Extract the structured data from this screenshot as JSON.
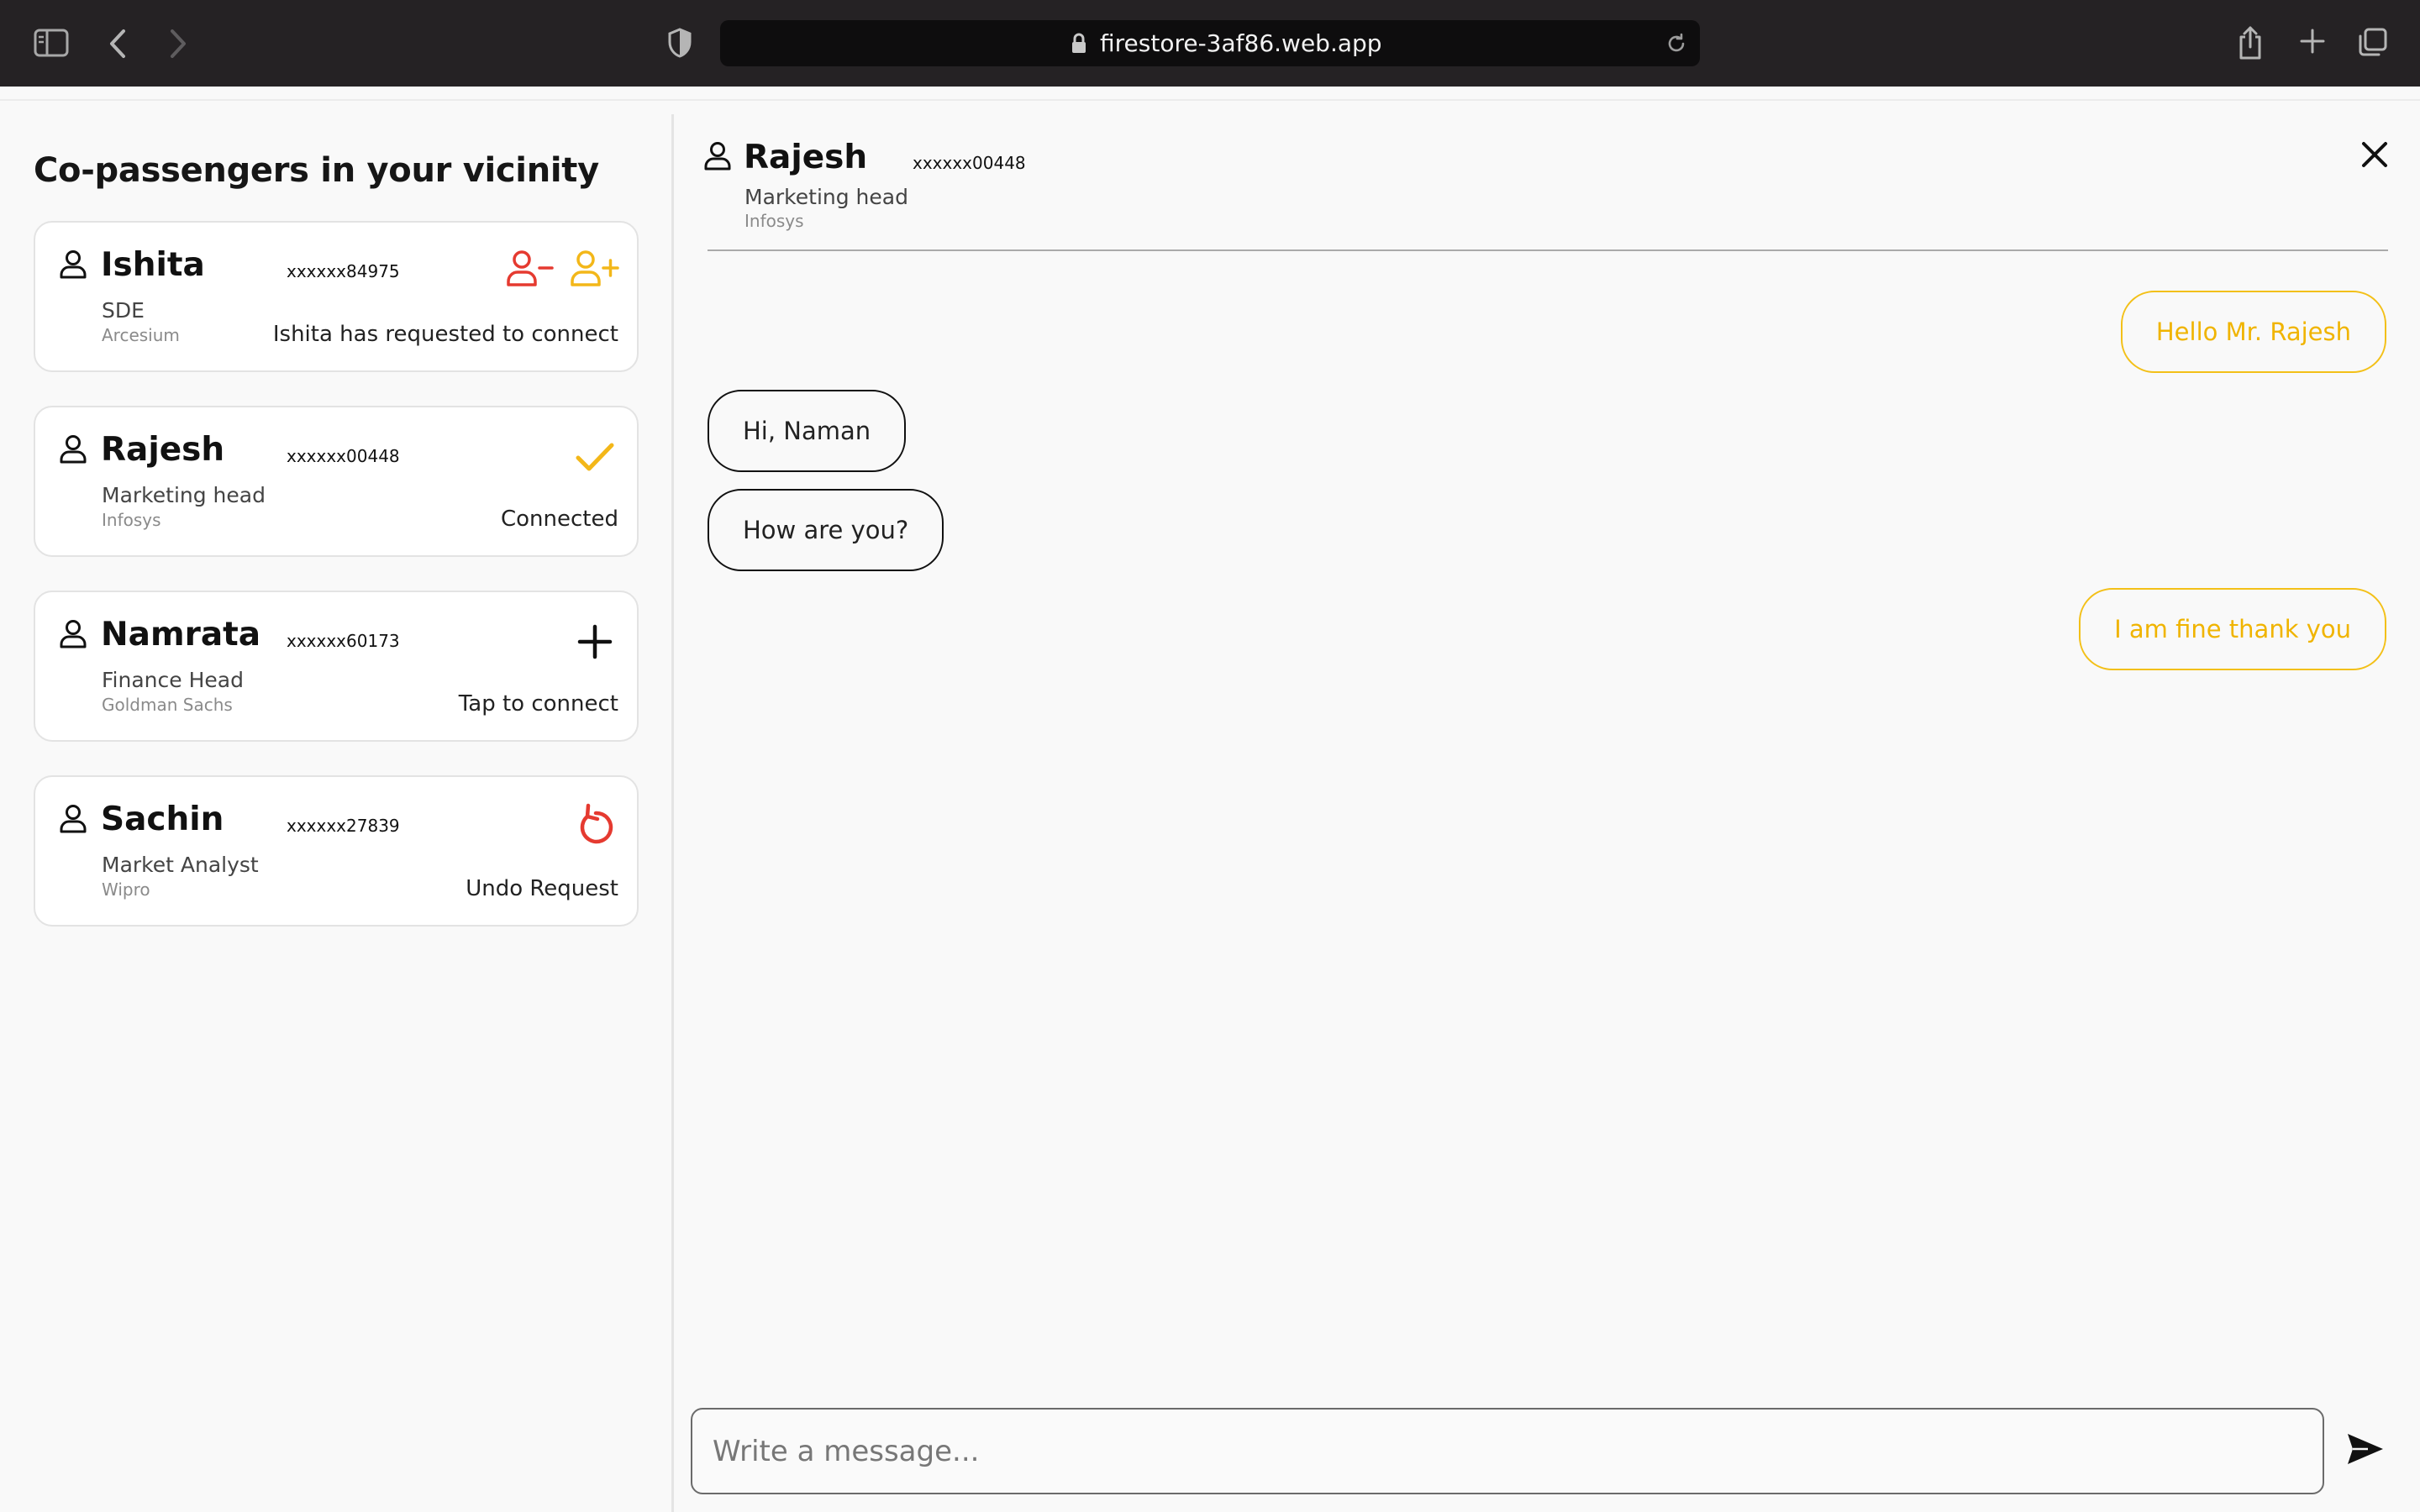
{
  "browser": {
    "url": "firestore-3af86.web.app"
  },
  "left": {
    "title": "Co-passengers in your vicinity",
    "cards": [
      {
        "name": "Ishita",
        "phone": "xxxxxx84975",
        "role": "SDE",
        "org": "Arcesium",
        "status": "Ishita has requested to connect"
      },
      {
        "name": "Rajesh",
        "phone": "xxxxxx00448",
        "role": "Marketing head",
        "org": "Infosys",
        "status": "Connected"
      },
      {
        "name": "Namrata",
        "phone": "xxxxxx60173",
        "role": "Finance Head",
        "org": "Goldman Sachs",
        "status": "Tap to connect"
      },
      {
        "name": "Sachin",
        "phone": "xxxxxx27839",
        "role": "Market Analyst",
        "org": "Wipro",
        "status": "Undo Request"
      }
    ]
  },
  "chat": {
    "name": "Rajesh",
    "phone": "xxxxxx00448",
    "role": "Marketing head",
    "org": "Infosys",
    "messages": [
      {
        "from": "me",
        "text": "Hello Mr. Rajesh"
      },
      {
        "from": "them",
        "text": "Hi, Naman"
      },
      {
        "from": "them",
        "text": "How are you?"
      },
      {
        "from": "me",
        "text": "I am fine thank you"
      }
    ],
    "input_placeholder": "Write a message..."
  },
  "colors": {
    "accent_yellow": "#f3b719",
    "danger_red": "#e53a30",
    "text": "#111111"
  }
}
